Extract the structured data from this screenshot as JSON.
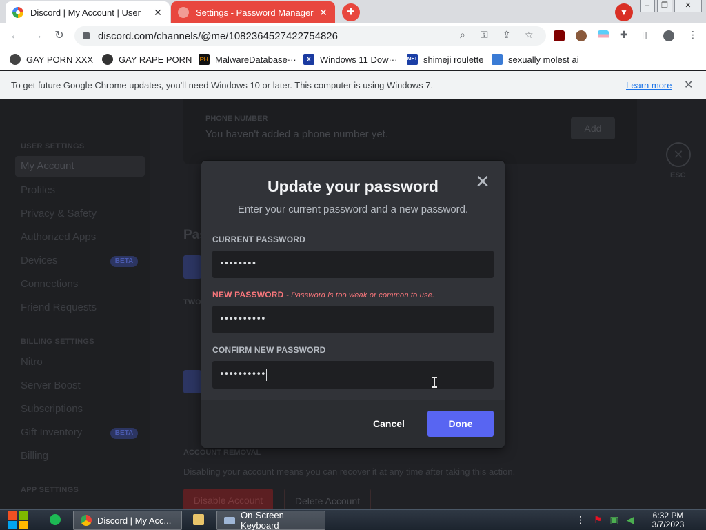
{
  "browser": {
    "tabs": [
      {
        "title": "Discord | My Account | User",
        "close": "✕"
      },
      {
        "title": "Settings - Password Manager",
        "close": "✕"
      }
    ],
    "new_tab": "+",
    "address": "discord.com/channels/@me/1082364527422754826",
    "window_controls": [
      "‒",
      "❐",
      "✕"
    ],
    "bookmarks": [
      {
        "label": "GAY PORN XXX",
        "icon": "discord-icon"
      },
      {
        "label": "GAY RAPE PORN",
        "icon": "globe-icon"
      },
      {
        "label": "MalwareDatabase···",
        "icon": "PH"
      },
      {
        "label": "Windows 11 Dow···",
        "icon": "X"
      },
      {
        "label": "shimeji roulette",
        "icon": "MFT"
      },
      {
        "label": "sexually molest ai",
        "icon": "bot-icon"
      }
    ],
    "infobar": {
      "message": "To get future Google Chrome updates, you'll need Windows 10 or later. This computer is using Windows 7.",
      "link": "Learn more",
      "close": "✕"
    }
  },
  "discord": {
    "sidebar": {
      "user_settings_header": "USER SETTINGS",
      "user_items": [
        "My Account",
        "Profiles",
        "Privacy & Safety",
        "Authorized Apps",
        "Devices",
        "Connections",
        "Friend Requests"
      ],
      "billing_header": "BILLING SETTINGS",
      "billing_items": [
        "Nitro",
        "Server Boost",
        "Subscriptions",
        "Gift Inventory",
        "Billing"
      ],
      "app_header": "APP SETTINGS",
      "beta_label": "BETA"
    },
    "background": {
      "phone_label": "PHONE NUMBER",
      "phone_value": "You haven't added a phone number yet.",
      "add_button": "Add",
      "esc_label": "ESC",
      "password_heading": "Pas",
      "two_factor_label": "TWO",
      "account_removal_header": "ACCOUNT REMOVAL",
      "account_removal_text": "Disabling your account means you can recover it at any time after taking this action.",
      "disable_button": "Disable Account",
      "delete_button": "Delete Account"
    },
    "modal": {
      "title": "Update your password",
      "subtitle": "Enter your current password and a new password.",
      "close": "✕",
      "current_label": "CURRENT PASSWORD",
      "current_value": "••••••••",
      "new_label": "NEW PASSWORD",
      "new_error": "- Password is too weak or common to use.",
      "new_value": "••••••••••",
      "confirm_label": "CONFIRM NEW PASSWORD",
      "confirm_value": "••••••••••",
      "cancel": "Cancel",
      "done": "Done"
    }
  },
  "taskbar": {
    "items": [
      {
        "label": "Discord | My Acc..."
      },
      {
        "label": "On-Screen Keyboard"
      }
    ],
    "time": "6:32 PM",
    "date": "3/7/2023"
  },
  "colors": {
    "blurple": "#5865f2",
    "error": "#fa777c",
    "modal_bg": "#313338",
    "chrome_tab_red": "#e8473e"
  }
}
